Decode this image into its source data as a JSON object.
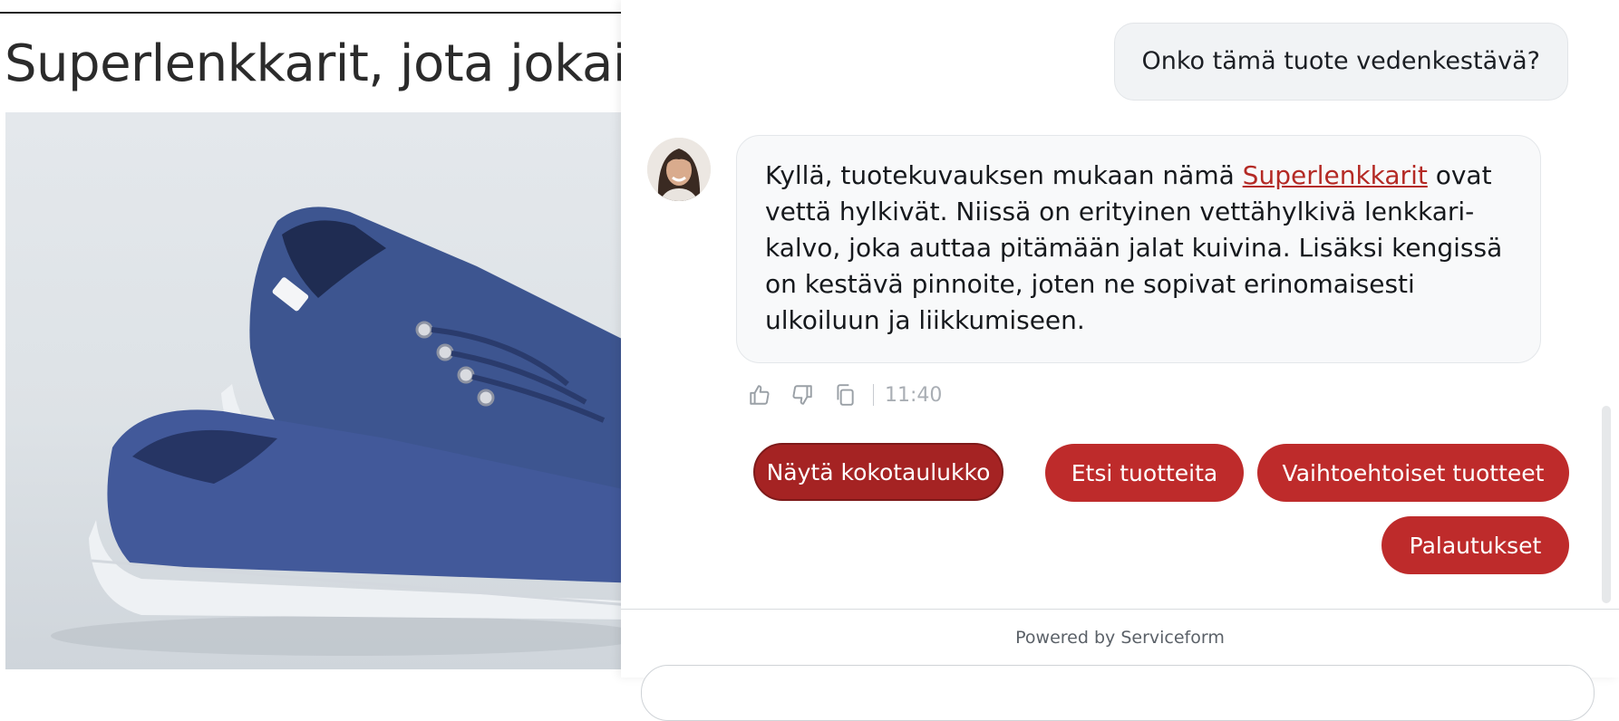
{
  "product": {
    "title": "Superlenkkarit, jota jokain"
  },
  "chat": {
    "user_message": "Onko tämä tuote vedenkestävä?",
    "bot_message": {
      "before_link": "Kyllä, tuotekuvauksen mukaan nämä ",
      "link_text": "Superlenkkarit",
      "after_link": " ovat vettä hylkivät. Niissä on erityinen vettähylkivä lenkkari-kalvo, joka auttaa pitämään jalat kuivina. Lisäksi kengissä on kestävä pinnoite, joten ne sopivat erinomaisesti ulkoiluun ja liikkumiseen."
    },
    "timestamp": "11:40",
    "icons": [
      "thumbs-up-icon",
      "thumbs-down-icon",
      "copy-icon"
    ],
    "suggestions": {
      "size_chart": "Näytä kokotaulukko",
      "search_products": "Etsi tuotteita",
      "alternative_products": "Vaihtoehtoiset tuotteet",
      "returns": "Palautukset"
    },
    "powered_by": "Powered by Serviceform"
  },
  "colors": {
    "accent": "#be2b2b",
    "accent_active": "#a52323",
    "link": "#b42a25"
  }
}
